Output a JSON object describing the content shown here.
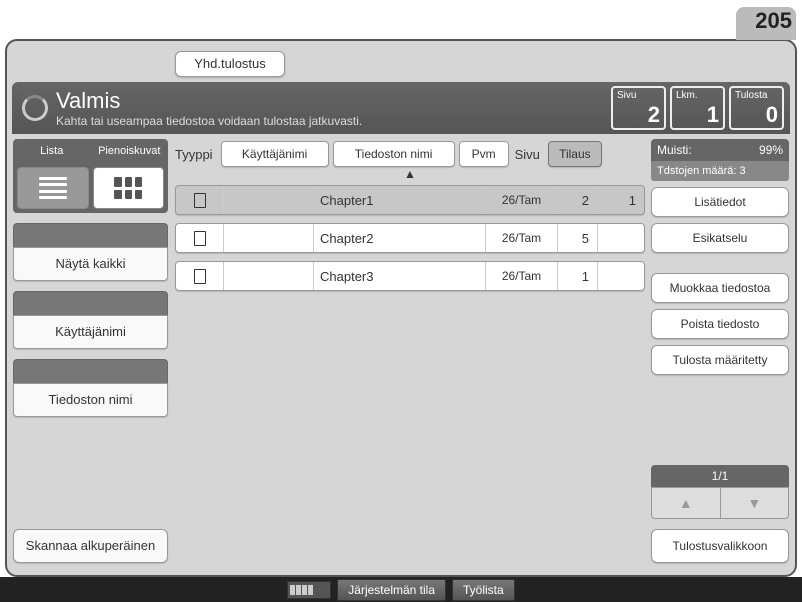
{
  "page_number_top": "205",
  "yhd_button": "Yhd.tulostus",
  "status": {
    "title": "Valmis",
    "subtitle": "Kahta tai useampaa tiedostoa voidaan tulostaa jatkuvasti."
  },
  "counters": {
    "sivu": {
      "label": "Sivu",
      "value": "2"
    },
    "lkm": {
      "label": "Lkm.",
      "value": "1"
    },
    "tulosta": {
      "label": "Tulosta",
      "value": "0"
    }
  },
  "left": {
    "view_labels": {
      "list": "Lista",
      "thumb": "Pienoiskuvat"
    },
    "show_all": "Näytä kaikki",
    "username": "Käyttäjänimi",
    "filename": "Tiedoston nimi",
    "scan_original": "Skannaa alkuperäinen"
  },
  "sort": {
    "type": "Tyyppi",
    "username": "Käyttäjänimi",
    "filename": "Tiedoston nimi",
    "date": "Pvm",
    "page_label": "Sivu",
    "order": "Tilaus"
  },
  "files": [
    {
      "name": "Chapter1",
      "date": "26/Tam",
      "pages": "2",
      "order": "1",
      "selected": true
    },
    {
      "name": "Chapter2",
      "date": "26/Tam",
      "pages": "5",
      "order": "",
      "selected": false
    },
    {
      "name": "Chapter3",
      "date": "26/Tam",
      "pages": "1",
      "order": "",
      "selected": false
    }
  ],
  "right": {
    "memory_label": "Muisti:",
    "memory_value": "99%",
    "file_count_label": "Tdstojen määrä:",
    "file_count_value": "3",
    "details": "Lisätiedot",
    "preview": "Esikatselu",
    "edit_file": "Muokkaa tiedostoa",
    "delete_file": "Poista tiedosto",
    "print_specified": "Tulosta määritetty",
    "pager": "1/1",
    "to_print_menu": "Tulostusvalikkoon"
  },
  "bottom": {
    "system_status": "Järjestelmän tila",
    "job_list": "Työlista"
  }
}
